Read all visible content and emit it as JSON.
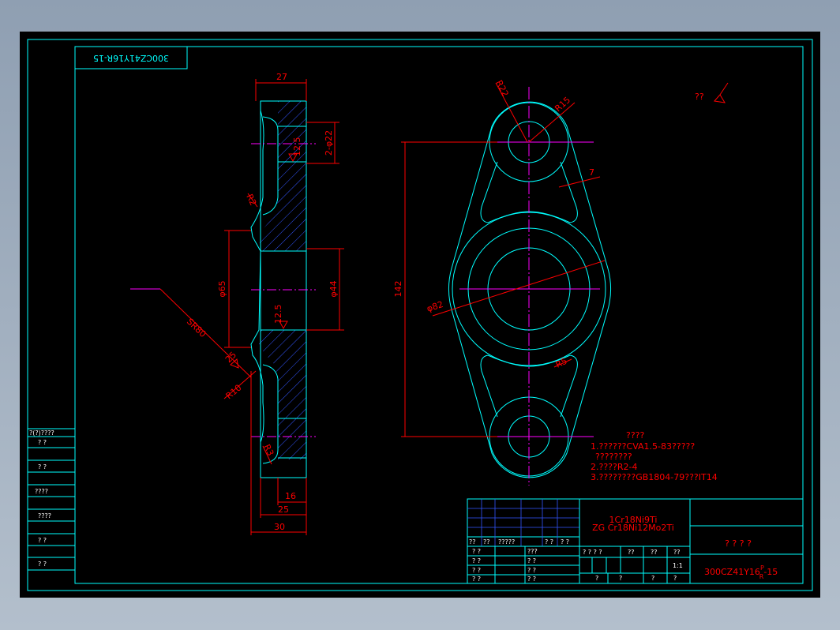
{
  "drawing": {
    "code_stamp": "300CZ41Y16R-15",
    "roughness_note": "??",
    "side_view": {
      "dim_27": "27",
      "dim_2phi22": "2-φ22",
      "dim_12_5_top": "12.5",
      "dim_R2": "R2",
      "dim_phi65": "φ65",
      "dim_phi44": "φ44",
      "dim_12_5_mid": "12.5",
      "dim_SR80": "SR80",
      "dim_25_small": "25",
      "dim_R10": "R10",
      "dim_R3": "R3",
      "dim_16": "16",
      "dim_25": "25",
      "dim_30": "30"
    },
    "front_view": {
      "dim_R22": "R22",
      "dim_R15": "R15",
      "dim_7": "7",
      "dim_142": "142",
      "dim_phi82": "φ82",
      "dim_R5": "R5"
    },
    "notes": {
      "title": "????",
      "line1": "1.??????CVA1.5-83?????",
      "line2": "????????",
      "line3": "2.????R2-4",
      "line4": "3.????????GB1804-79???IT14"
    }
  },
  "left_table": {
    "header": "?(?)????",
    "rows": [
      "?  ?",
      "?  ?",
      "????",
      "????",
      "?  ?",
      "?  ?"
    ]
  },
  "title_block": {
    "material_line1": "1Cr18Ni9Ti",
    "material_line2": "ZG Cr18Ni12Mo2Ti",
    "part_name": "? ? ? ?",
    "drawing_number": "300CZ41Y16",
    "drawing_number_sup": "P",
    "drawing_number_sub": "R",
    "drawing_number_suffix": "-15",
    "scale": "1:1",
    "sign_header": [
      "??",
      "??",
      "?????",
      "? ?",
      "? ?"
    ],
    "sign_rows": [
      [
        "? ?",
        "???"
      ],
      [
        "? ?",
        "? ?"
      ],
      [
        "? ?",
        "? ?"
      ],
      [
        "? ?",
        "? ?"
      ]
    ],
    "stage_header": [
      "? ? ? ?",
      "??",
      "??",
      "??"
    ],
    "bottom_cells": [
      "?",
      "?",
      "?",
      "?"
    ]
  }
}
